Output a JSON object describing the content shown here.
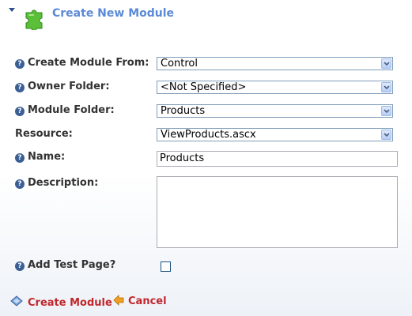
{
  "header": {
    "title": "Create New Module"
  },
  "form": {
    "create_from": {
      "label": "Create Module From:",
      "value": "Control"
    },
    "owner_folder": {
      "label": "Owner Folder:",
      "value": "<Not Specified>"
    },
    "module_folder": {
      "label": "Module Folder:",
      "value": "Products"
    },
    "resource": {
      "label": "Resource:",
      "value": "ViewProducts.ascx"
    },
    "name": {
      "label": "Name:",
      "value": "Products"
    },
    "description": {
      "label": "Description:",
      "value": ""
    },
    "add_test_page": {
      "label": "Add Test Page?",
      "checked": false
    }
  },
  "actions": {
    "create_label": "Create Module",
    "cancel_label": "Cancel"
  },
  "colors": {
    "title": "#5b8ad6",
    "action_link": "#c0272d",
    "help_icon": "#3b5f94"
  }
}
